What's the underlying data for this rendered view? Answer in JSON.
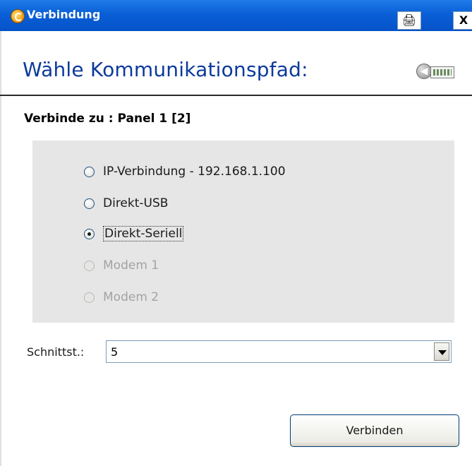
{
  "window": {
    "title": "Verbindung",
    "print_glyph": "🖨",
    "close_glyph": "X"
  },
  "header": {
    "heading": "Wähle Kommunikationspfad:",
    "nav_glyph": "◀"
  },
  "target": {
    "label": "Verbinde zu : Panel 1 [2]"
  },
  "options": [
    {
      "label": "IP-Verbindung - 192.168.1.100",
      "checked": false,
      "enabled": true
    },
    {
      "label": "Direkt-USB",
      "checked": false,
      "enabled": true
    },
    {
      "label": "Direkt-Seriell",
      "checked": true,
      "enabled": true
    },
    {
      "label": "Modem 1",
      "checked": false,
      "enabled": false
    },
    {
      "label": "Modem 2",
      "checked": false,
      "enabled": false
    }
  ],
  "interface": {
    "label": "Schnittst.:",
    "value": "5"
  },
  "actions": {
    "connect_label": "Verbinden"
  }
}
